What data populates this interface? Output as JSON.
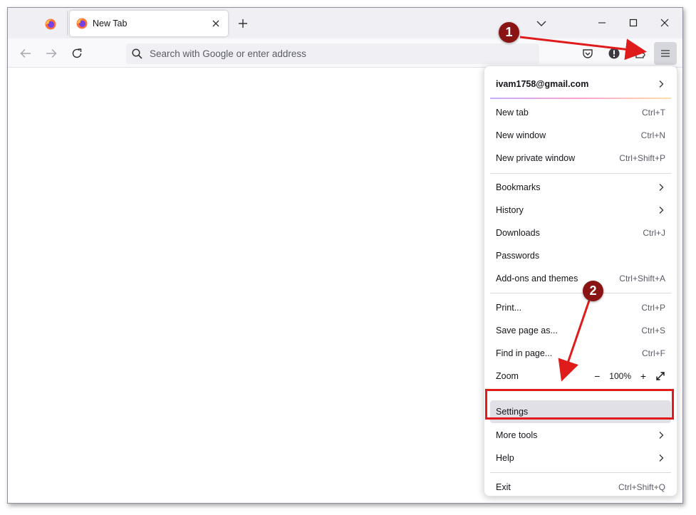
{
  "tabs": {
    "active_title": "New Tab"
  },
  "urlbar": {
    "placeholder": "Search with Google or enter address"
  },
  "menu": {
    "account": "ivam1758@gmail.com",
    "items": [
      {
        "label": "New tab",
        "shortcut": "Ctrl+T"
      },
      {
        "label": "New window",
        "shortcut": "Ctrl+N"
      },
      {
        "label": "New private window",
        "shortcut": "Ctrl+Shift+P"
      },
      {
        "label": "Bookmarks",
        "shortcut": ""
      },
      {
        "label": "History",
        "shortcut": ""
      },
      {
        "label": "Downloads",
        "shortcut": "Ctrl+J"
      },
      {
        "label": "Passwords",
        "shortcut": ""
      },
      {
        "label": "Add-ons and themes",
        "shortcut": "Ctrl+Shift+A"
      },
      {
        "label": "Print...",
        "shortcut": "Ctrl+P"
      },
      {
        "label": "Save page as...",
        "shortcut": "Ctrl+S"
      },
      {
        "label": "Find in page...",
        "shortcut": "Ctrl+F"
      },
      {
        "label": "Zoom",
        "shortcut": ""
      },
      {
        "label": "Settings",
        "shortcut": ""
      },
      {
        "label": "More tools",
        "shortcut": ""
      },
      {
        "label": "Help",
        "shortcut": ""
      },
      {
        "label": "Exit",
        "shortcut": "Ctrl+Shift+Q"
      }
    ],
    "zoom": {
      "minus": "−",
      "value": "100%",
      "plus": "+"
    }
  },
  "annotations": {
    "step1": "1",
    "step2": "2"
  },
  "colors": {
    "annotation_red": "#e01b1b",
    "annotation_badge": "#8a1414",
    "menu_button_active": "#d6d6dd",
    "settings_highlight": "#e0e0e6"
  },
  "icons": {
    "pinned_tab": "firefox-icon",
    "active_tab": "firefox-icon",
    "tab_close": "close-icon",
    "new_tab": "plus-icon",
    "tabs_list": "chevron-down-icon",
    "back": "arrow-left-icon",
    "forward": "arrow-right-icon",
    "reload": "reload-icon",
    "search": "search-icon",
    "pocket": "pocket-icon",
    "extension": "info-extension-icon",
    "puzzle": "puzzle-icon",
    "app_menu": "hamburger-menu-icon",
    "fullscreen": "fullscreen-icon"
  }
}
